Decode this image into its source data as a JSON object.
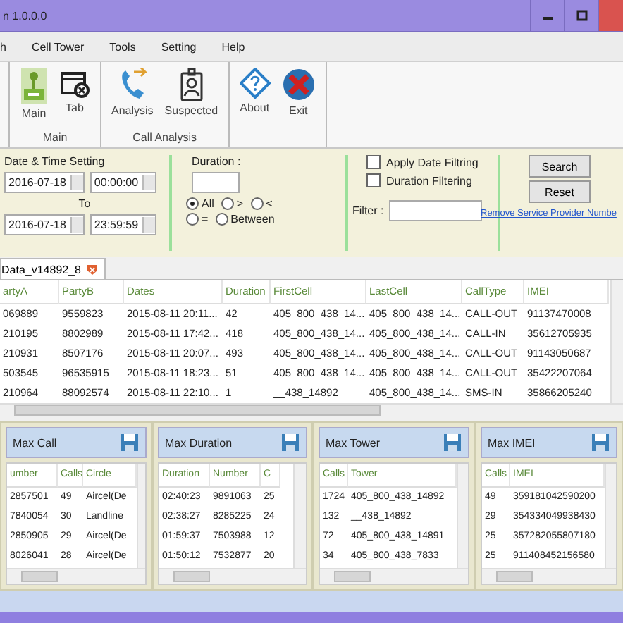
{
  "window": {
    "title": "n 1.0.0.0"
  },
  "menu": [
    "h",
    "Cell Tower",
    "Tools",
    "Setting",
    "Help"
  ],
  "ribbon": {
    "groups": [
      {
        "label": "Main",
        "buttons": [
          {
            "label": "Main",
            "kind": "tower"
          },
          {
            "label": "Tab",
            "kind": "tab"
          }
        ]
      },
      {
        "label": "Call Analysis",
        "buttons": [
          {
            "label": "Analysis",
            "kind": "phone"
          },
          {
            "label": "Suspected",
            "kind": "badge"
          }
        ]
      },
      {
        "buttons": [
          {
            "label": "About",
            "kind": "about"
          },
          {
            "label": "Exit",
            "kind": "exit"
          }
        ]
      }
    ]
  },
  "filters": {
    "date_title": "Date & Time Setting",
    "from_date": "2016-07-18",
    "from_time": "00:00:00",
    "to_label": "To",
    "to_date": "2016-07-18",
    "to_time": "23:59:59",
    "duration_label": "Duration :",
    "duration_options": [
      {
        "label": "All",
        "selected": true
      },
      {
        "label": ">",
        "selected": false
      },
      {
        "label": "<",
        "selected": false
      },
      {
        "label": "=",
        "selected": false
      },
      {
        "label": "Between",
        "selected": false
      }
    ],
    "checkboxes": [
      {
        "label": "Apply Date Filtring",
        "checked": false
      },
      {
        "label": "Duration Filtering",
        "checked": false
      }
    ],
    "filter_label": "Filter :",
    "buttons": [
      "Search",
      "Reset"
    ],
    "link": "Remove Service Provider Numbe"
  },
  "tab": {
    "label": "Data_v14892_8"
  },
  "table": {
    "columns": [
      "artyA",
      "PartyB",
      "Dates",
      "Duration",
      "FirstCell",
      "LastCell",
      "CallType",
      "IMEI"
    ],
    "rows": [
      [
        "069889",
        "9559823",
        "2015-08-11 20:11...",
        "42",
        "405_800_438_14...",
        "405_800_438_14...",
        "CALL-OUT",
        "91137470008"
      ],
      [
        "210195",
        "8802989",
        "2015-08-11 17:42...",
        "418",
        "405_800_438_14...",
        "405_800_438_14...",
        "CALL-IN",
        "35612705935"
      ],
      [
        "210931",
        "8507176",
        "2015-08-11 20:07...",
        "493",
        "405_800_438_14...",
        "405_800_438_14...",
        "CALL-OUT",
        "91143050687"
      ],
      [
        "503545",
        "96535915",
        "2015-08-11 18:23...",
        "51",
        "405_800_438_14...",
        "405_800_438_14...",
        "CALL-OUT",
        "35422207064"
      ],
      [
        "210964",
        "88092574",
        "2015-08-11 22:10...",
        "1",
        "__438_14892",
        "405_800_438_14...",
        "SMS-IN",
        "35866205240"
      ]
    ]
  },
  "panels": [
    {
      "title": "Max Call",
      "columns": [
        "umber",
        "Calls",
        "Circle"
      ],
      "rows": [
        [
          "2857501",
          "49",
          "Aircel(De"
        ],
        [
          "7840054",
          "30",
          "Landline"
        ],
        [
          "2850905",
          "29",
          "Aircel(De"
        ],
        [
          "8026041",
          "28",
          "Aircel(De"
        ]
      ]
    },
    {
      "title": "Max Duration",
      "columns": [
        "Duration",
        "Number",
        "C"
      ],
      "rows": [
        [
          "02:40:23",
          "9891063",
          "25"
        ],
        [
          "02:38:27",
          "8285225",
          "24"
        ],
        [
          "01:59:37",
          "7503988",
          "12"
        ],
        [
          "01:50:12",
          "7532877",
          "20"
        ]
      ]
    },
    {
      "title": "Max Tower",
      "columns": [
        "Calls",
        "Tower"
      ],
      "rows": [
        [
          "1724",
          "405_800_438_14892"
        ],
        [
          "132",
          "__438_14892"
        ],
        [
          "72",
          "405_800_438_14891"
        ],
        [
          "34",
          "405_800_438_7833"
        ]
      ]
    },
    {
      "title": "Max IMEI",
      "columns": [
        "Calls",
        "IMEI"
      ],
      "rows": [
        [
          "49",
          "359181042590200"
        ],
        [
          "29",
          "354334049938430"
        ],
        [
          "25",
          "357282055807180"
        ],
        [
          "25",
          "911408452156580"
        ]
      ]
    }
  ]
}
